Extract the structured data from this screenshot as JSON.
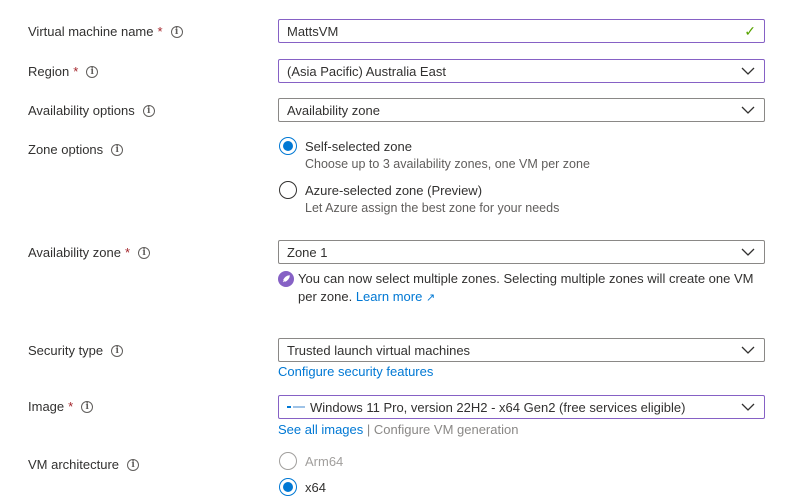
{
  "vm_name": {
    "label": "Virtual machine name",
    "value": "MattsVM",
    "valid": true
  },
  "region": {
    "label": "Region",
    "value": "(Asia Pacific) Australia East"
  },
  "availability_options": {
    "label": "Availability options",
    "value": "Availability zone"
  },
  "zone_options": {
    "label": "Zone options",
    "options": [
      {
        "title": "Self-selected zone",
        "desc": "Choose up to 3 availability zones, one VM per zone",
        "selected": true
      },
      {
        "title": "Azure-selected zone (Preview)",
        "desc": "Let Azure assign the best zone for your needs",
        "selected": false
      }
    ]
  },
  "availability_zone": {
    "label": "Availability zone",
    "value": "Zone 1",
    "note": "You can now select multiple zones. Selecting multiple zones will create one VM per zone.",
    "note_link": "Learn more"
  },
  "security_type": {
    "label": "Security type",
    "value": "Trusted launch virtual machines",
    "link": "Configure security features"
  },
  "image": {
    "label": "Image",
    "value": "Windows 11 Pro, version 22H2 - x64 Gen2 (free services eligible)",
    "link_all": "See all images",
    "separator": "|",
    "link_config": "Configure VM generation"
  },
  "vm_architecture": {
    "label": "VM architecture",
    "options": [
      {
        "title": "Arm64",
        "selected": false,
        "disabled": true
      },
      {
        "title": "x64",
        "selected": true,
        "disabled": false
      }
    ]
  },
  "colors": {
    "accent": "#0078d4",
    "focus_border": "#8661c5",
    "required": "#a4262c",
    "valid": "#57a300"
  }
}
